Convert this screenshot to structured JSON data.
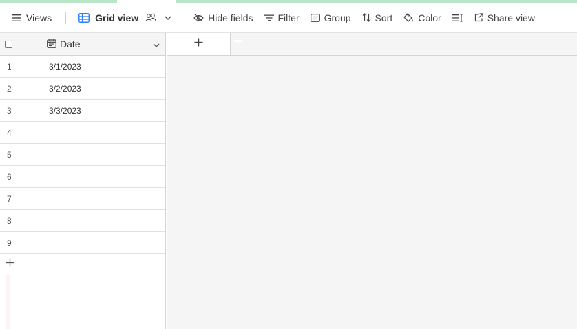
{
  "toolbar": {
    "views_label": "Views",
    "grid_view_label": "Grid view",
    "hide_fields_label": "Hide fields",
    "filter_label": "Filter",
    "group_label": "Group",
    "sort_label": "Sort",
    "color_label": "Color",
    "share_view_label": "Share view"
  },
  "grid": {
    "field_name": "Date",
    "rows": [
      {
        "num": "1",
        "date": "3/1/2023"
      },
      {
        "num": "2",
        "date": "3/2/2023"
      },
      {
        "num": "3",
        "date": "3/3/2023"
      },
      {
        "num": "4",
        "date": ""
      },
      {
        "num": "5",
        "date": ""
      },
      {
        "num": "6",
        "date": ""
      },
      {
        "num": "7",
        "date": ""
      },
      {
        "num": "8",
        "date": ""
      },
      {
        "num": "9",
        "date": ""
      }
    ]
  },
  "colors": {
    "accent_strip": "#b9e6c6",
    "grid_icon": "#2d7ff9",
    "empty_area": "#f5f5f5"
  },
  "icons": {
    "views": "hamburger-icon",
    "grid_view": "grid-table-icon",
    "collaborators": "people-icon",
    "hide_fields": "eye-slash-icon",
    "filter": "filter-lines-icon",
    "group": "group-box-icon",
    "sort": "sort-arrows-icon",
    "color": "paint-bucket-icon",
    "row_height": "row-height-icon",
    "share": "external-link-icon"
  }
}
